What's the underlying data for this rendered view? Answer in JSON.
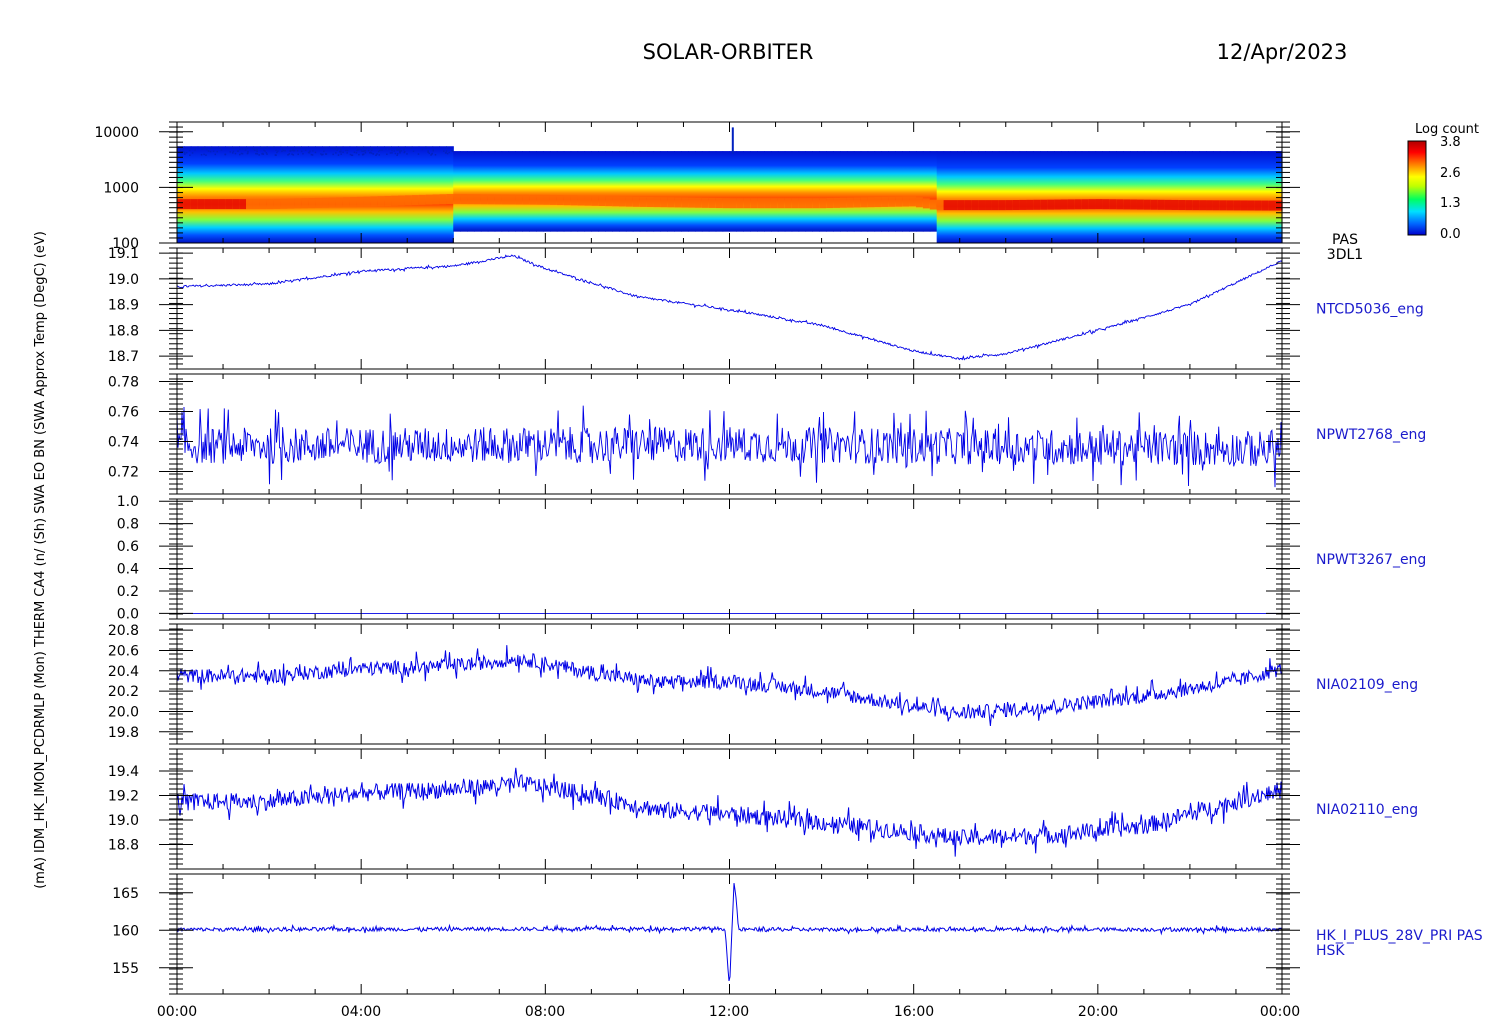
{
  "header": {
    "mission": "SOLAR-ORBITER",
    "date": "12/Apr/2023"
  },
  "x_axis": {
    "tick_labels": [
      "00:00",
      "04:00",
      "08:00",
      "12:00",
      "16:00",
      "20:00",
      "00:00"
    ]
  },
  "colorbar": {
    "title": "Log count",
    "tick_labels": [
      "3.8",
      "2.6",
      "1.3",
      "0.0"
    ],
    "colors": [
      "#0000cc",
      "#0066ff",
      "#00e0ff",
      "#00ff60",
      "#c0ff00",
      "#ffff00",
      "#ff8000",
      "#ff0000",
      "#b00000"
    ]
  },
  "left_axis_label": "(mA) IDM_HK_IMON_PCDRMLP (Mon) THERM CA4 (n/ (Sh) SWA EO BN (SWA Approx Temp (DegC) (eV)",
  "chart_data": [
    {
      "type": "heatmap",
      "name": "PAS 3DL1",
      "right_label": [
        "PAS",
        "3DL1"
      ],
      "y_scale": "log",
      "ylim": [
        100,
        15000
      ],
      "ytick_labels": [
        "10000",
        "1000",
        "100"
      ],
      "ytick_values": [
        10000,
        1000,
        100
      ],
      "colorbar_range": [
        0.0,
        3.8
      ],
      "peak_energy_profile": {
        "hours": [
          0,
          2,
          4,
          6,
          8,
          10,
          12,
          14,
          16,
          16.5,
          18,
          20,
          22,
          24
        ],
        "peak_eV": [
          500,
          500,
          550,
          620,
          600,
          550,
          520,
          520,
          560,
          480,
          480,
          500,
          480,
          470
        ]
      }
    },
    {
      "type": "line",
      "name": "NTCD5036_eng",
      "right_label": "NTCD5036_eng",
      "ylim": [
        18.65,
        19.12
      ],
      "ytick_labels": [
        "19.1",
        "19.0",
        "18.9",
        "18.8",
        "18.7"
      ],
      "ytick_values": [
        19.1,
        19.0,
        18.9,
        18.8,
        18.7
      ],
      "x_hours": [
        0,
        2,
        4,
        6,
        7.3,
        8,
        10,
        12,
        14,
        16,
        17,
        18,
        20,
        22,
        24
      ],
      "y": [
        18.97,
        18.98,
        19.03,
        19.05,
        19.09,
        19.04,
        18.93,
        18.88,
        18.82,
        18.72,
        18.69,
        18.71,
        18.8,
        18.9,
        19.07
      ],
      "noise": 0.004
    },
    {
      "type": "line",
      "name": "NPWT2768_eng",
      "right_label": "NPWT2768_eng",
      "ylim": [
        0.705,
        0.785
      ],
      "ytick_labels": [
        "0.78",
        "0.76",
        "0.74",
        "0.72"
      ],
      "ytick_values": [
        0.78,
        0.76,
        0.74,
        0.72
      ],
      "x_hours": [
        0,
        12,
        24
      ],
      "y": [
        0.737,
        0.738,
        0.735
      ],
      "noise": 0.012
    },
    {
      "type": "line",
      "name": "NPWT3267_eng",
      "right_label": "NPWT3267_eng",
      "ylim": [
        -0.05,
        1.02
      ],
      "ytick_labels": [
        "1.0",
        "0.8",
        "0.6",
        "0.4",
        "0.2",
        "0.0"
      ],
      "ytick_values": [
        1.0,
        0.8,
        0.6,
        0.4,
        0.2,
        0.0
      ],
      "x_hours": [
        0,
        24
      ],
      "y": [
        0.0,
        0.0
      ],
      "noise": 0.0
    },
    {
      "type": "line",
      "name": "NIA02109_eng",
      "right_label": "NIA02109_eng",
      "ylim": [
        19.68,
        20.86
      ],
      "ytick_labels": [
        "20.8",
        "20.6",
        "20.4",
        "20.2",
        "20.0",
        "19.8"
      ],
      "ytick_values": [
        20.8,
        20.6,
        20.4,
        20.2,
        20.0,
        19.8
      ],
      "x_hours": [
        0,
        2,
        4,
        6,
        7.5,
        9,
        10.5,
        12,
        14,
        16,
        17,
        19,
        21,
        23,
        24
      ],
      "y": [
        20.35,
        20.35,
        20.42,
        20.45,
        20.52,
        20.38,
        20.28,
        20.3,
        20.2,
        20.05,
        19.98,
        20.05,
        20.15,
        20.3,
        20.42
      ],
      "noise": 0.07
    },
    {
      "type": "line",
      "name": "NIA02110_eng",
      "right_label": "NIA02110_eng",
      "ylim": [
        18.6,
        19.58
      ],
      "ytick_labels": [
        "19.4",
        "19.2",
        "19.0",
        "18.8"
      ],
      "ytick_values": [
        19.4,
        19.2,
        19.0,
        18.8
      ],
      "x_hours": [
        0,
        2,
        4,
        6,
        7.5,
        9,
        10.5,
        12,
        14,
        16,
        17,
        19,
        21,
        23,
        24
      ],
      "y": [
        19.15,
        19.15,
        19.22,
        19.25,
        19.3,
        19.2,
        19.08,
        19.05,
        18.98,
        18.9,
        18.85,
        18.88,
        18.95,
        19.15,
        19.25
      ],
      "noise": 0.07
    },
    {
      "type": "line",
      "name": "HK_I_PLUS_28V_PRI PAS HSK",
      "right_label": [
        "HK_I_PLUS_28V_PRI PAS",
        "HSK"
      ],
      "ylim": [
        151.5,
        167.5
      ],
      "ytick_labels": [
        "165",
        "160",
        "155"
      ],
      "ytick_values": [
        165,
        160,
        155
      ],
      "x_hours": [
        0,
        11.9,
        12.0,
        12.1,
        12.2,
        24
      ],
      "y": [
        160.1,
        160.2,
        152.5,
        166.5,
        160.1,
        160.1
      ],
      "noise": 0.25
    }
  ]
}
